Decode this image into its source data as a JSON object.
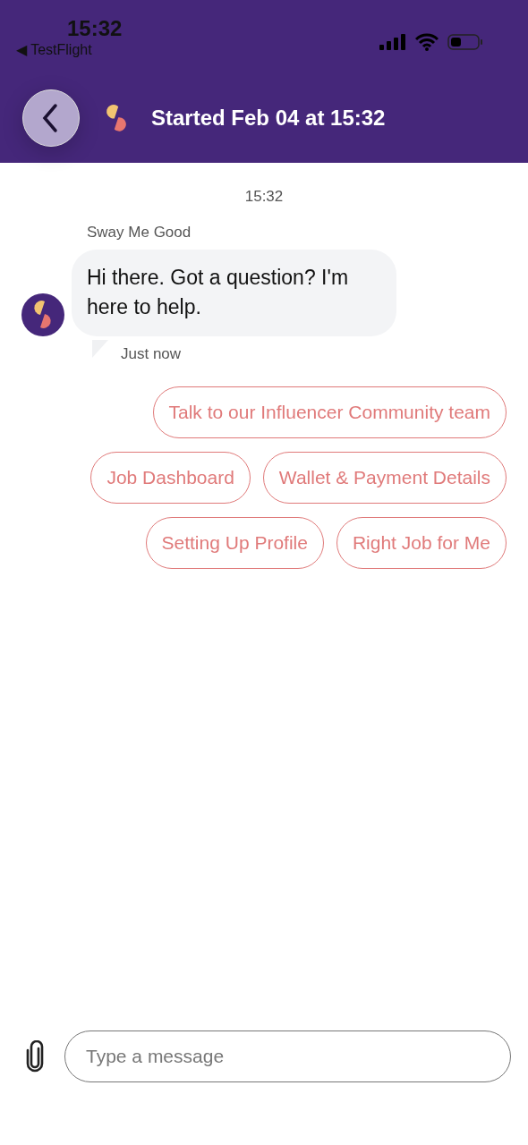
{
  "status_bar": {
    "time": "15:32",
    "back_app": "◀ TestFlight"
  },
  "header": {
    "title": "Started Feb 04 at 15:32"
  },
  "conversation": {
    "timestamp": "15:32",
    "sender": "Sway Me Good",
    "message": "Hi there. Got a question? I'm here to help.",
    "sent": "Just now"
  },
  "quick_reply_rows": [
    {
      "options": [
        "Talk to our Influencer Community team"
      ]
    },
    {
      "options": [
        "Job Dashboard",
        "Wallet & Payment Details"
      ]
    },
    {
      "options": [
        "Setting Up Profile",
        "Right Job for Me"
      ]
    }
  ],
  "composer": {
    "placeholder": "Type a message"
  }
}
